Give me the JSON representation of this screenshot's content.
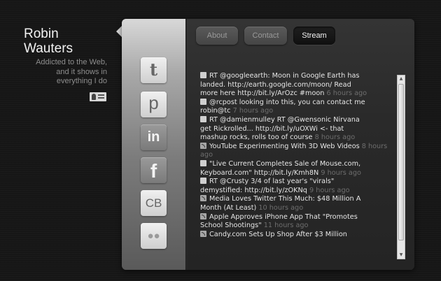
{
  "profile": {
    "name_first": "Robin",
    "name_last": "Wauters",
    "tagline_line1": "Addicted to the Web,",
    "tagline_line2": "and it shows in",
    "tagline_line3": "everything I do"
  },
  "sidebar": {
    "items": [
      {
        "label": "t",
        "icon": "twitter-icon"
      },
      {
        "label": "p",
        "icon": "posterous-icon"
      },
      {
        "label": "in",
        "icon": "linkedin-icon"
      },
      {
        "label": "f",
        "icon": "facebook-icon"
      },
      {
        "label": "CB",
        "icon": "crunchbase-icon"
      },
      {
        "label": "●●",
        "icon": "flickr-icon"
      }
    ]
  },
  "tabs": [
    {
      "label": "About"
    },
    {
      "label": "Contact"
    },
    {
      "label": "Stream"
    }
  ],
  "active_tab": "Stream",
  "stream": {
    "items": [
      {
        "type": "twitter",
        "lines": [
          "RT @googleearth: Moon in Google Earth has",
          "landed. http://earth.google.com/moon/ Read",
          "more here http://bit.ly/ArOzc #moon "
        ],
        "time": "6 hours ago"
      },
      {
        "type": "twitter",
        "lines": [
          "@rcpost looking into this, you can contact me",
          "robin@tc "
        ],
        "time": "7 hours ago"
      },
      {
        "type": "twitter",
        "lines": [
          "RT @damienmulley RT @Gwensonic Nirvana",
          "get Rickrolled... http://bit.ly/uOXWi <- that",
          "mashup rocks, rolls too of course "
        ],
        "time": "8 hours ago"
      },
      {
        "type": "rss",
        "lines": [
          "YouTube Experimenting With 3D Web Videos "
        ],
        "time": "8 hours ago"
      },
      {
        "type": "twitter",
        "lines": [
          "\"Live Current Completes Sale of Mouse.com,",
          "Keyboard.com\" http://bit.ly/Kmh8N "
        ],
        "time": "9 hours ago"
      },
      {
        "type": "twitter",
        "lines": [
          "RT @Crusty 3/4 of last year's \"virals\"",
          "demystified: http://bit.ly/zOKNq "
        ],
        "time": "9 hours ago"
      },
      {
        "type": "rss",
        "lines": [
          "Media Loves Twitter This Much: $48 Million A",
          "Month (At Least) "
        ],
        "time": "10 hours ago"
      },
      {
        "type": "rss",
        "lines": [
          "Apple Approves iPhone App That \"Promotes",
          "School Shootings\" "
        ],
        "time": "11 hours ago"
      },
      {
        "type": "rss",
        "lines": [
          "Candy.com Sets Up Shop After $3 Million"
        ],
        "time": ""
      }
    ]
  },
  "colors": {
    "background": "#161616",
    "panel": "#2c2c2c",
    "active_tab": "#101010",
    "timestamp": "#6e6e6e"
  }
}
